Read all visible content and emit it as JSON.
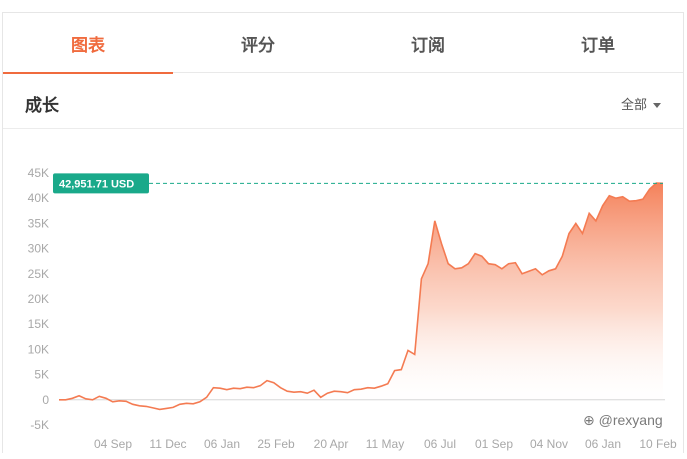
{
  "tabs": [
    {
      "label": "图表",
      "active": true
    },
    {
      "label": "评分",
      "active": false
    },
    {
      "label": "订阅",
      "active": false
    },
    {
      "label": "订单",
      "active": false
    }
  ],
  "section": {
    "title": "成长",
    "range_label": "全部"
  },
  "watermark": "⊕ @rexyang",
  "colors": {
    "accent": "#f06b3e",
    "line": "#f47b52",
    "badge": "#1aa98a"
  },
  "chart_data": {
    "type": "area",
    "y_ticks": [
      -5000,
      0,
      5000,
      10000,
      15000,
      20000,
      25000,
      30000,
      35000,
      40000,
      45000
    ],
    "y_tick_labels": [
      "-5K",
      "0",
      "5K",
      "10K",
      "15K",
      "20K",
      "25K",
      "30K",
      "35K",
      "40K",
      "45K"
    ],
    "x_tick_labels": [
      "04 Sep",
      "11 Dec",
      "06 Jan",
      "25 Feb",
      "20 Apr",
      "11 May",
      "06 Jul",
      "01 Sep",
      "04 Nov",
      "06 Jan",
      "10 Feb"
    ],
    "ylim": [
      -5000,
      45000
    ],
    "current_value": 42951.71,
    "current_label": "42,951.71 USD",
    "grid": false,
    "values": [
      0,
      0,
      300,
      800,
      200,
      0,
      700,
      300,
      -400,
      -200,
      -300,
      -900,
      -1200,
      -1300,
      -1600,
      -1900,
      -1700,
      -1500,
      -900,
      -700,
      -800,
      -400,
      500,
      2400,
      2300,
      2000,
      2300,
      2200,
      2500,
      2400,
      2800,
      3800,
      3400,
      2400,
      1700,
      1500,
      1600,
      1300,
      1900,
      500,
      1300,
      1700,
      1600,
      1400,
      2000,
      2100,
      2400,
      2300,
      2700,
      3200,
      5800,
      6000,
      9800,
      9000,
      24000,
      27000,
      35500,
      31000,
      27000,
      26000,
      26200,
      27000,
      29000,
      28500,
      27000,
      26800,
      26000,
      27000,
      27200,
      25000,
      25500,
      26000,
      24800,
      25600,
      26000,
      28500,
      33000,
      35000,
      33000,
      37000,
      35500,
      38500,
      40500,
      40000,
      40300,
      39400,
      39500,
      39800,
      41800,
      43000,
      42951.71
    ]
  }
}
